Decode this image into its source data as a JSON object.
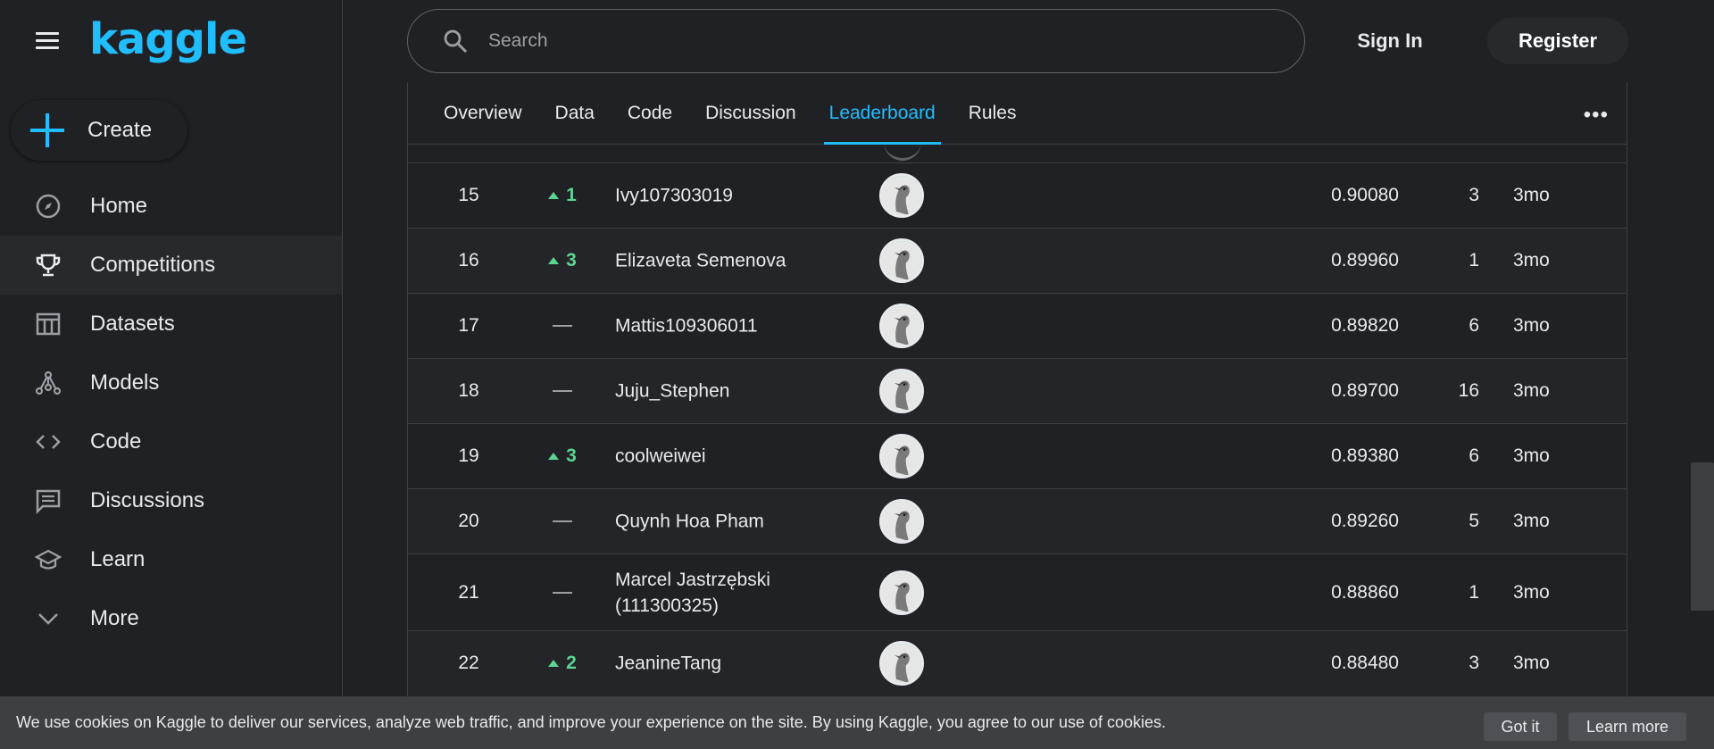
{
  "app": {
    "logo": "kaggle",
    "brand_color": "#20beff"
  },
  "sidebar": {
    "create_label": "Create",
    "items": [
      {
        "label": "Home",
        "icon": "compass-icon",
        "active": false
      },
      {
        "label": "Competitions",
        "icon": "trophy-icon",
        "active": true
      },
      {
        "label": "Datasets",
        "icon": "table-icon",
        "active": false
      },
      {
        "label": "Models",
        "icon": "models-icon",
        "active": false
      },
      {
        "label": "Code",
        "icon": "code-icon",
        "active": false
      },
      {
        "label": "Discussions",
        "icon": "comment-icon",
        "active": false
      },
      {
        "label": "Learn",
        "icon": "graduation-cap-icon",
        "active": false
      },
      {
        "label": "More",
        "icon": "chevron-down-icon",
        "active": false
      }
    ]
  },
  "header": {
    "search_placeholder": "Search",
    "sign_in": "Sign In",
    "register": "Register"
  },
  "tabs": [
    {
      "label": "Overview",
      "active": false
    },
    {
      "label": "Data",
      "active": false
    },
    {
      "label": "Code",
      "active": false
    },
    {
      "label": "Discussion",
      "active": false
    },
    {
      "label": "Leaderboard",
      "active": true
    },
    {
      "label": "Rules",
      "active": false
    }
  ],
  "leaderboard": {
    "rows": [
      {
        "rank": "15",
        "delta": "1",
        "direction": "up",
        "team": "Ivy107303019",
        "score": "0.90080",
        "entries": "3",
        "last": "3mo"
      },
      {
        "rank": "16",
        "delta": "3",
        "direction": "up",
        "team": "Elizaveta Semenova",
        "score": "0.89960",
        "entries": "1",
        "last": "3mo"
      },
      {
        "rank": "17",
        "delta": "",
        "direction": "none",
        "team": "Mattis109306011",
        "score": "0.89820",
        "entries": "6",
        "last": "3mo"
      },
      {
        "rank": "18",
        "delta": "",
        "direction": "none",
        "team": "Juju_Stephen",
        "score": "0.89700",
        "entries": "16",
        "last": "3mo"
      },
      {
        "rank": "19",
        "delta": "3",
        "direction": "up",
        "team": "coolweiwei",
        "score": "0.89380",
        "entries": "6",
        "last": "3mo"
      },
      {
        "rank": "20",
        "delta": "",
        "direction": "none",
        "team": "Quynh Hoa Pham",
        "score": "0.89260",
        "entries": "5",
        "last": "3mo"
      },
      {
        "rank": "21",
        "delta": "",
        "direction": "none",
        "team": "Marcel Jastrzębski (111300325)",
        "score": "0.88860",
        "entries": "1",
        "last": "3mo"
      },
      {
        "rank": "22",
        "delta": "2",
        "direction": "up",
        "team": "JeanineTang",
        "score": "0.88480",
        "entries": "3",
        "last": "3mo"
      }
    ]
  },
  "cookie_banner": {
    "text": "We use cookies on Kaggle to deliver our services, analyze web traffic, and improve your experience on the site. By using Kaggle, you agree to our use of cookies.",
    "got_it": "Got it",
    "learn_more": "Learn more"
  }
}
